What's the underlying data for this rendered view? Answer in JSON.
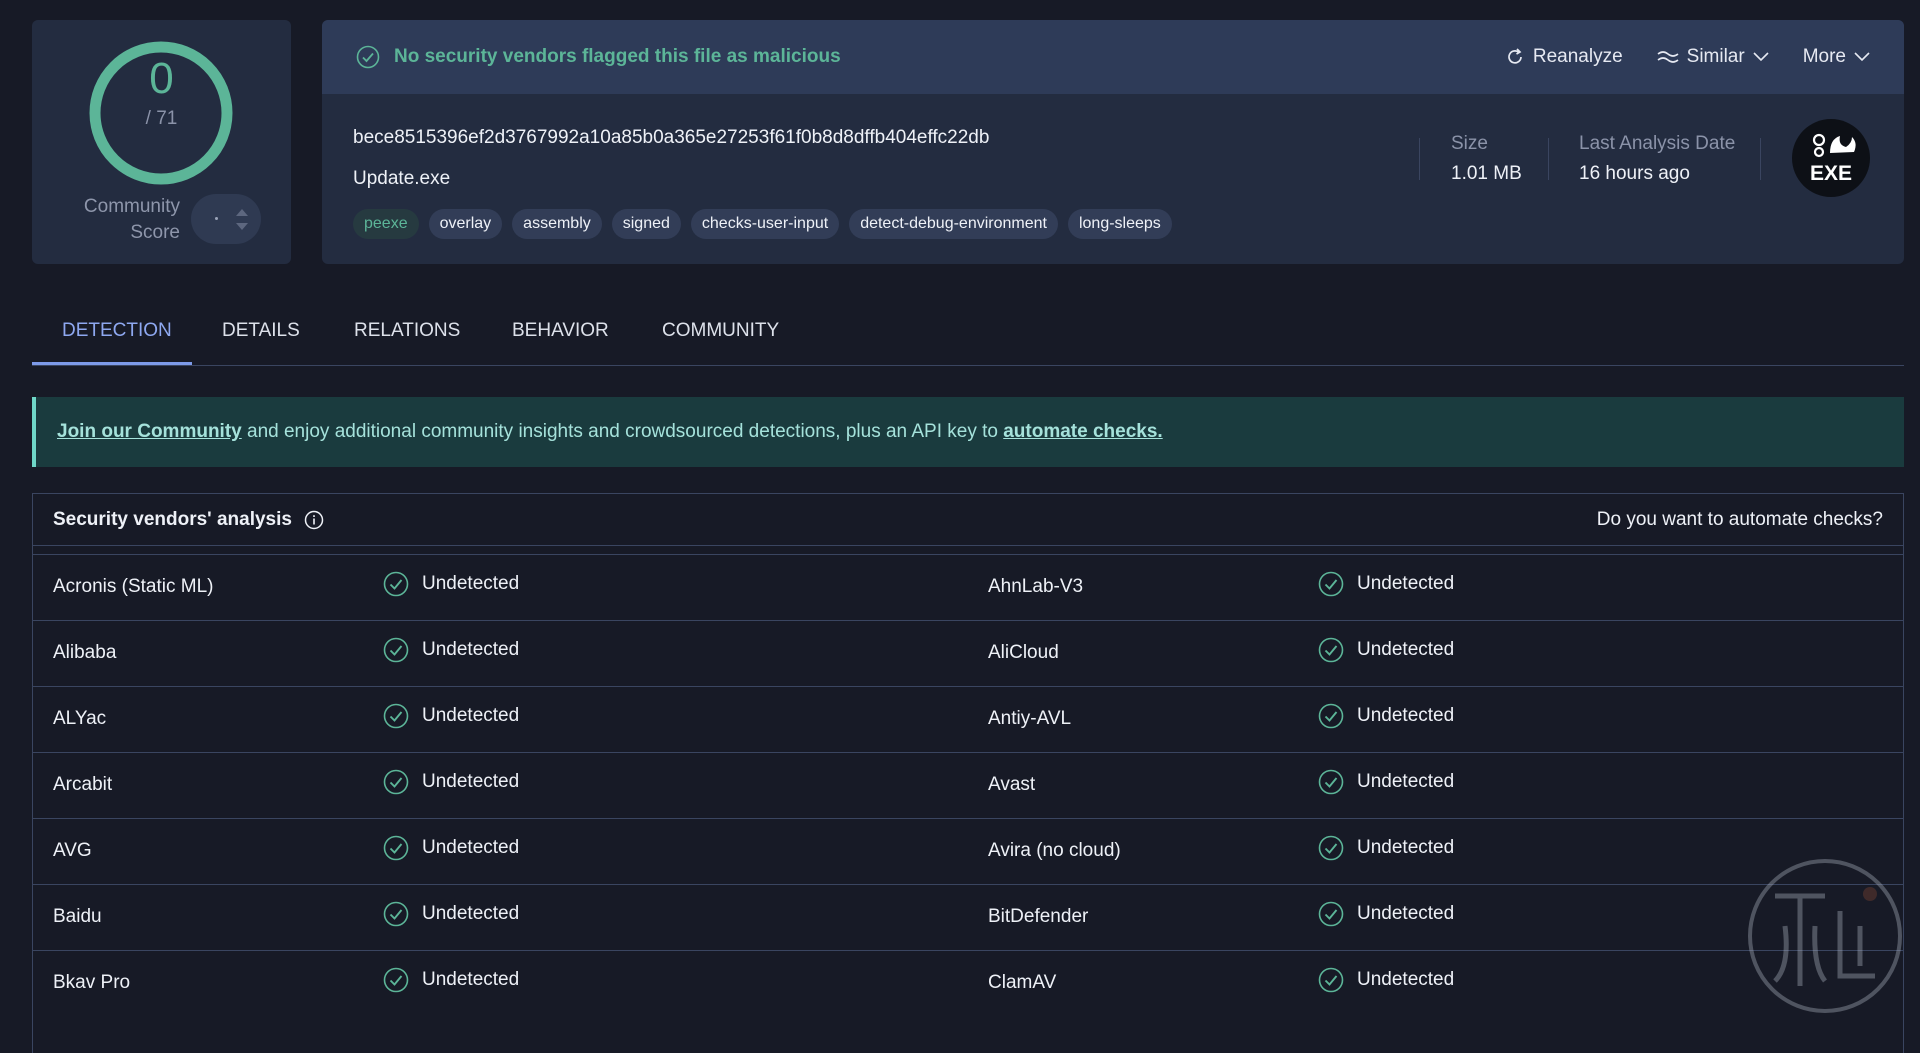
{
  "score": {
    "value": "0",
    "total": "/ 71",
    "community_label_line1": "Community",
    "community_label_line2": "Score"
  },
  "banner": {
    "status": "No security vendors flagged this file as malicious",
    "actions": {
      "reanalyze": "Reanalyze",
      "similar": "Similar",
      "more": "More"
    }
  },
  "file": {
    "hash": "bece8515396ef2d3767992a10a85b0a365e27253f61f0b8d8dffb404effc22db",
    "name": "Update.exe",
    "tags": [
      "peexe",
      "overlay",
      "assembly",
      "signed",
      "checks-user-input",
      "detect-debug-environment",
      "long-sleeps"
    ],
    "size_label": "Size",
    "size_value": "1.01 MB",
    "date_label": "Last Analysis Date",
    "date_value": "16 hours ago",
    "type_icon_text": "EXE"
  },
  "tabs": [
    "DETECTION",
    "DETAILS",
    "RELATIONS",
    "BEHAVIOR",
    "COMMUNITY"
  ],
  "join": {
    "link1": "Join our Community",
    "middle": " and enjoy additional community insights and crowdsourced detections, plus an API key to ",
    "link2": "automate checks."
  },
  "analysis": {
    "title": "Security vendors' analysis",
    "right_link": "Do you want to automate checks?",
    "rows": [
      {
        "left_vendor": "Acronis (Static ML)",
        "left_result": "Undetected",
        "right_vendor": "AhnLab-V3",
        "right_result": "Undetected"
      },
      {
        "left_vendor": "Alibaba",
        "left_result": "Undetected",
        "right_vendor": "AliCloud",
        "right_result": "Undetected"
      },
      {
        "left_vendor": "ALYac",
        "left_result": "Undetected",
        "right_vendor": "Antiy-AVL",
        "right_result": "Undetected"
      },
      {
        "left_vendor": "Arcabit",
        "left_result": "Undetected",
        "right_vendor": "Avast",
        "right_result": "Undetected"
      },
      {
        "left_vendor": "AVG",
        "left_result": "Undetected",
        "right_vendor": "Avira (no cloud)",
        "right_result": "Undetected"
      },
      {
        "left_vendor": "Baidu",
        "left_result": "Undetected",
        "right_vendor": "BitDefender",
        "right_result": "Undetected"
      },
      {
        "left_vendor": "Bkav Pro",
        "left_result": "Undetected",
        "right_vendor": "ClamAV",
        "right_result": "Undetected"
      }
    ]
  },
  "colors": {
    "accent_green": "#5cb598",
    "tab_active": "#8ea8f0",
    "join_bg": "#1a3b3e"
  },
  "icons": [
    "check-circle-icon",
    "reanalyze-icon",
    "similar-icon",
    "chevron-down-icon",
    "info-icon",
    "exe-file-icon",
    "vote-arrows-icon"
  ]
}
